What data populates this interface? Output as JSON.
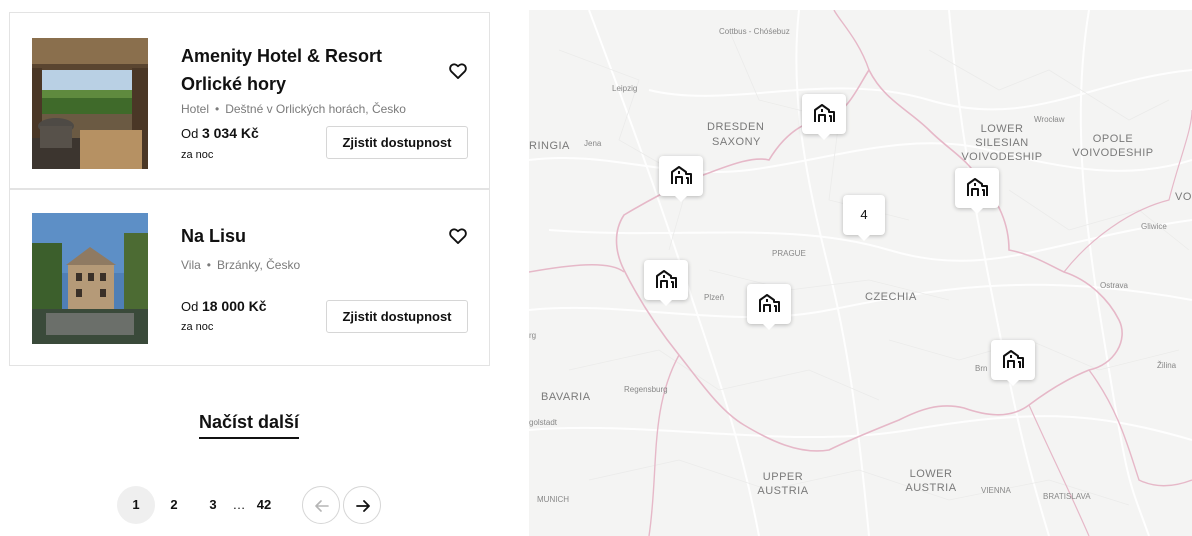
{
  "listings": [
    {
      "name": "Amenity Hotel & Resort Orlické hory",
      "type": "Hotel",
      "location": "Deštné v Orlických horách, Česko",
      "price_prefix": "Od",
      "price": "3 034 Kč",
      "per_night": "za noc",
      "button": "Zjistit dostupnost",
      "favorite_icon": "heart-outline-icon"
    },
    {
      "name": "Na Lisu",
      "type": "Vila",
      "location": "Brzánky, Česko",
      "price_prefix": "Od",
      "price": "18 000 Kč",
      "per_night": "za noc",
      "button": "Zjistit dostupnost",
      "favorite_icon": "heart-outline-icon"
    }
  ],
  "load_more": "Načíst další",
  "pagination": {
    "pages": [
      "1",
      "2",
      "3",
      "…",
      "42"
    ],
    "current": "1",
    "prev_icon": "arrow-left-icon",
    "next_icon": "arrow-right-icon"
  },
  "map": {
    "labels": {
      "cottbus": "Cottbus - Chóśebuz",
      "leipzig": "Leipzig",
      "dresden": "DRESDEN",
      "saxony": "SAXONY",
      "ringia": "RINGIA",
      "jena": "Jena",
      "wroclaw": "Wrocław",
      "lower_silesian": "LOWER SILESIAN VOIVODESHIP",
      "opole": "OPOLE VOIVODESHIP",
      "vo": "VO",
      "gliwice": "Gliwice",
      "prague": "PRAGUE",
      "czechia": "CZECHIA",
      "plzen": "Plzeň",
      "ostrava": "Ostrava",
      "zilina": "Žilina",
      "brno": "Brn",
      "bavaria": "BAVARIA",
      "regensburg": "Regensburg",
      "ingolstadt": "golstadt",
      "rg": "rg",
      "munich": "MUNICH",
      "upper_austria": "UPPER AUSTRIA",
      "lower_austria": "LOWER AUSTRIA",
      "vienna": "VIENNA",
      "bratislava": "BRATISLAVA"
    },
    "cluster_count": "4",
    "marker_icon": "hotel-building-icon",
    "colors": {
      "background": "#f4f4f3",
      "border": "#e6b8c8",
      "roads": "#ffffff"
    }
  }
}
